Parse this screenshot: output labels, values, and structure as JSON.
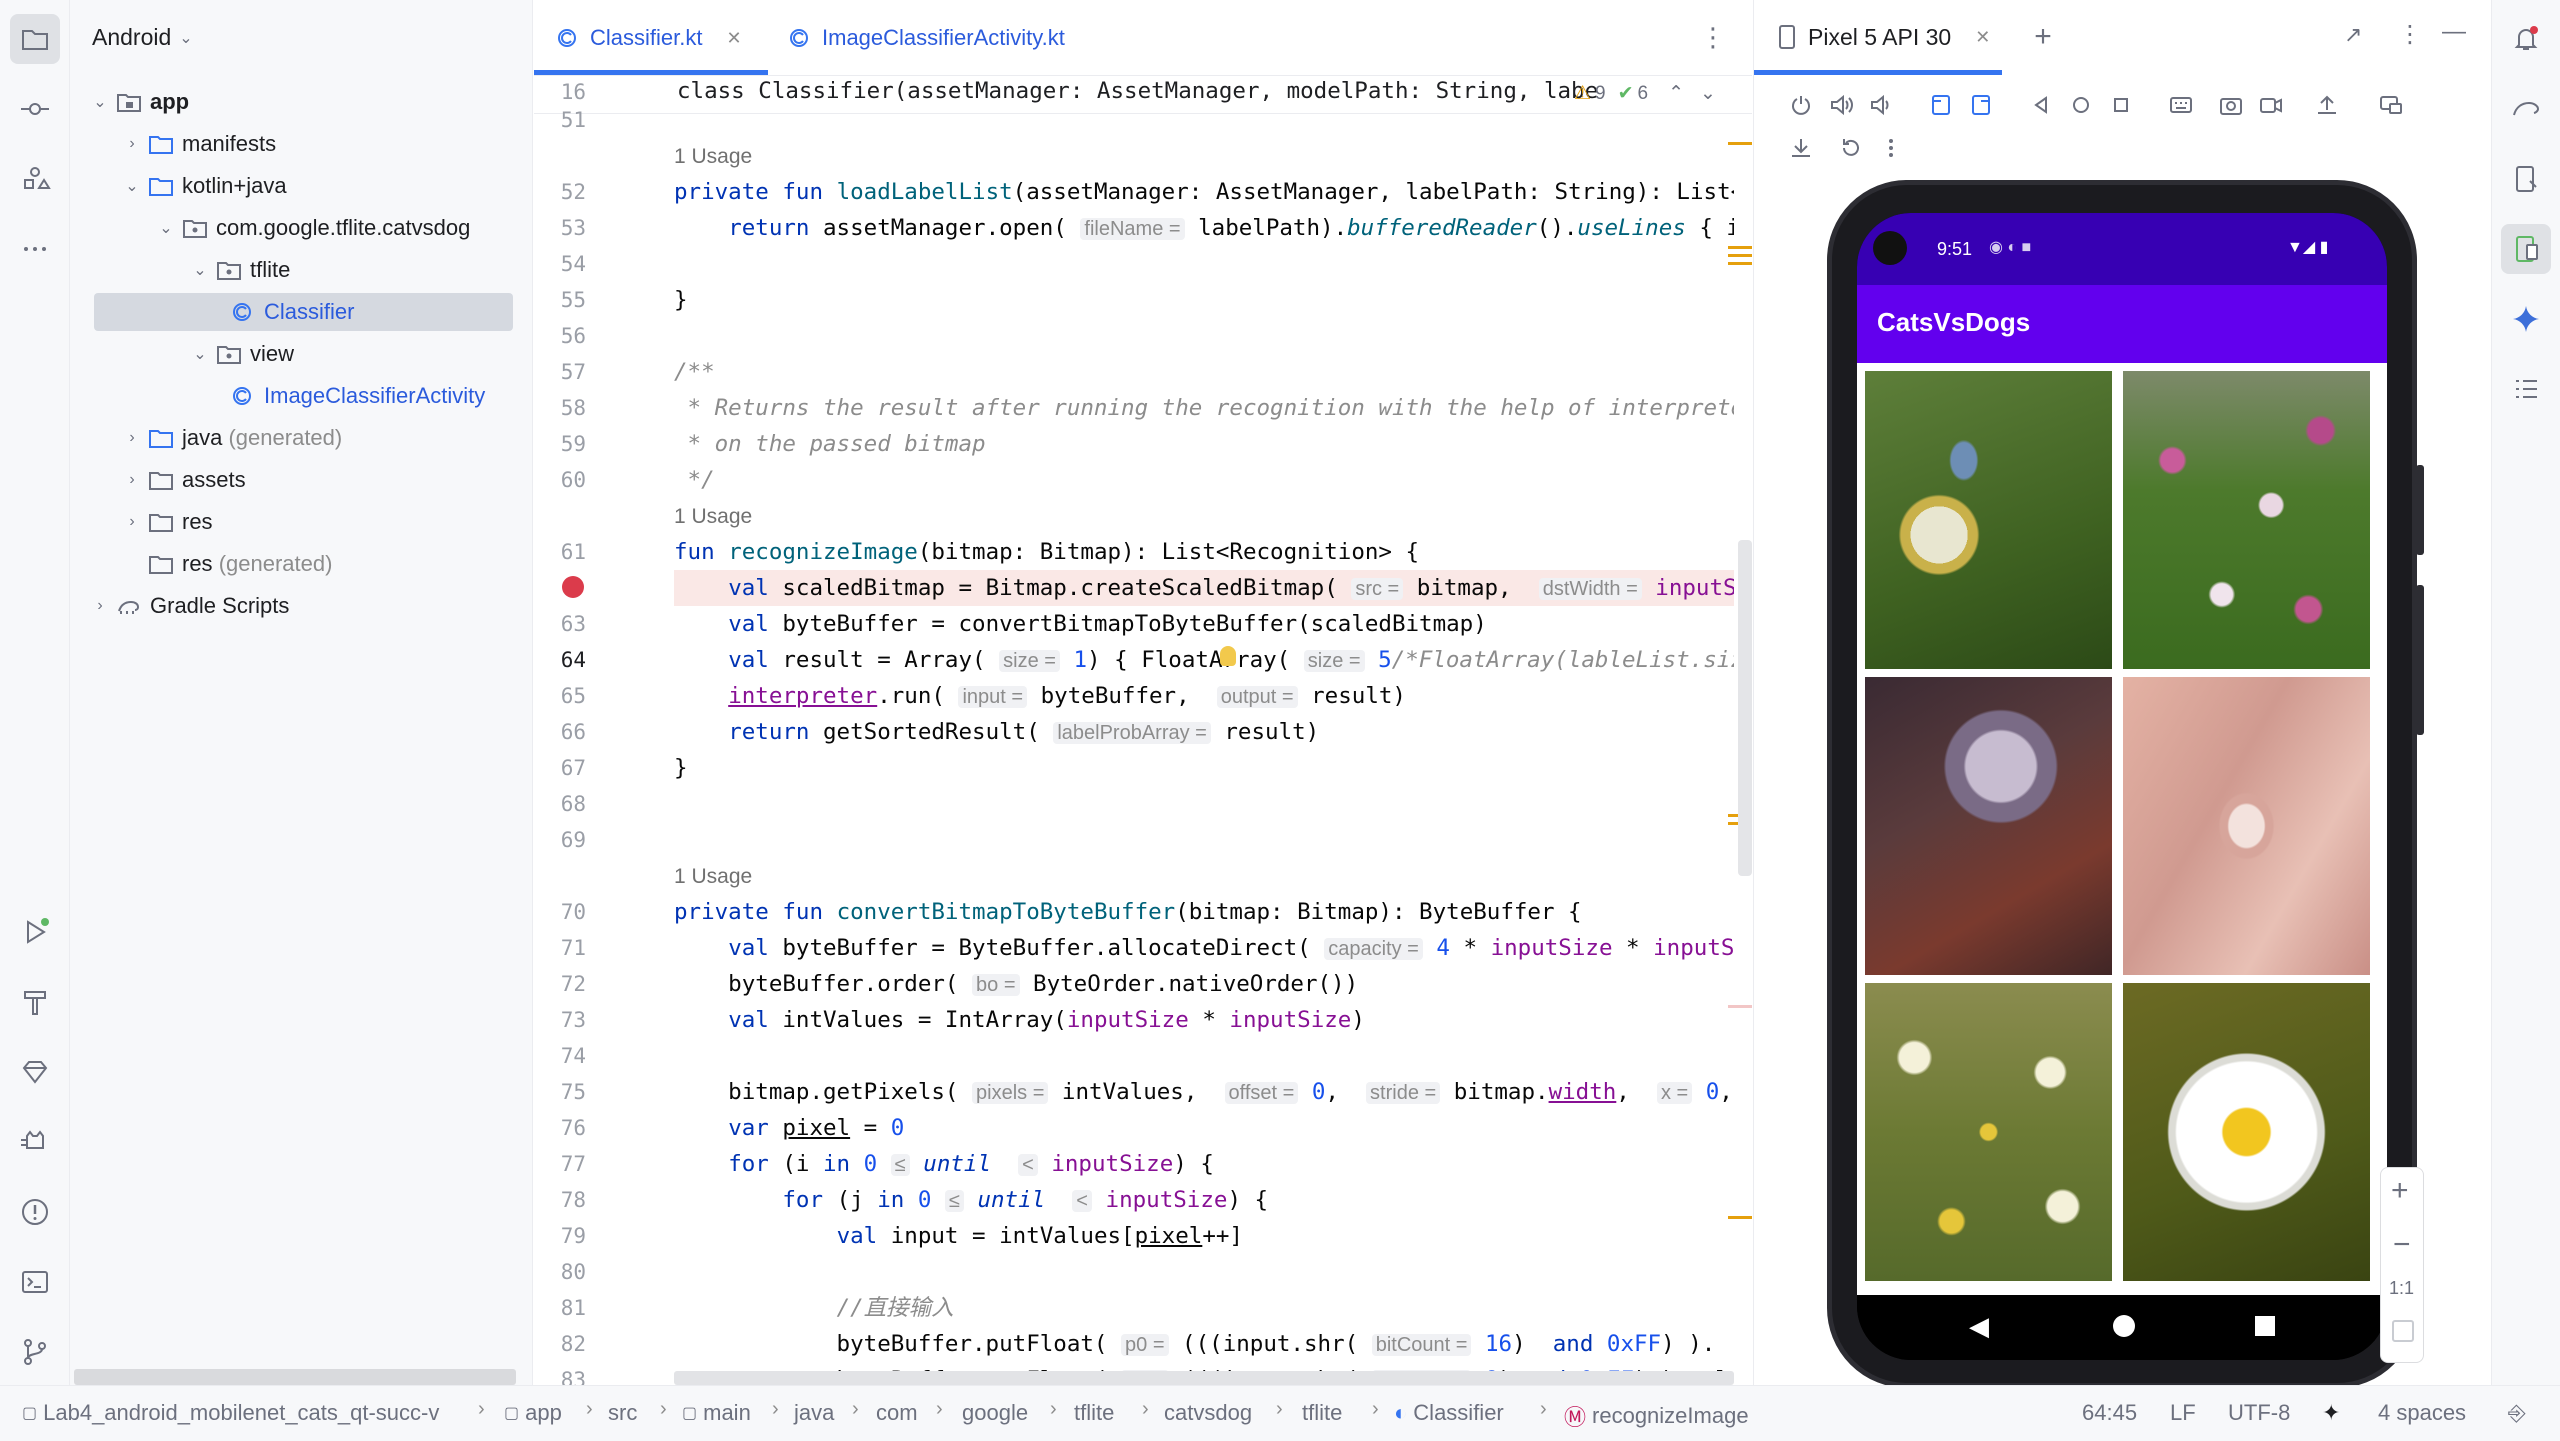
{
  "project_panel": {
    "title": "Android",
    "tree": [
      {
        "label": "app",
        "extra": ""
      },
      {
        "label": "manifests",
        "extra": ""
      },
      {
        "label": "kotlin+java",
        "extra": ""
      },
      {
        "label": "com.google.tflite.catvsdog",
        "extra": ""
      },
      {
        "label": "tflite",
        "extra": ""
      },
      {
        "label": "Classifier",
        "extra": ""
      },
      {
        "label": "view",
        "extra": ""
      },
      {
        "label": "ImageClassifierActivity",
        "extra": ""
      },
      {
        "label": "java",
        "extra": "(generated)"
      },
      {
        "label": "assets",
        "extra": ""
      },
      {
        "label": "res",
        "extra": ""
      },
      {
        "label": "res",
        "extra": "(generated)"
      },
      {
        "label": "Gradle Scripts",
        "extra": ""
      }
    ]
  },
  "editor": {
    "tabs": [
      {
        "label": "Classifier.kt",
        "active": true
      },
      {
        "label": "ImageClassifierActivity.kt",
        "active": false
      }
    ],
    "sticky": {
      "line": "16",
      "text": "class Classifier(assetManager: AssetManager, modelPath: String, labe",
      "warnings": "9",
      "ok": "6"
    },
    "line_numbers": [
      "51",
      "52",
      "53",
      "54",
      "55",
      "56",
      "57",
      "58",
      "59",
      "60",
      "61",
      "63",
      "64",
      "65",
      "66",
      "67",
      "68",
      "69",
      "70",
      "71",
      "72",
      "73",
      "74",
      "75",
      "76",
      "77",
      "78",
      "79",
      "80",
      "81",
      "82",
      "83"
    ],
    "usage_label": "1 Usage"
  },
  "device": {
    "tab_label": "Pixel 5 API 30",
    "time": "9:51",
    "app_title": "CatsVsDogs",
    "zoom_label": "1:1"
  },
  "status": {
    "breadcrumbs": [
      "Lab4_android_mobilenet_cats_qt-succ-v",
      "app",
      "src",
      "main",
      "java",
      "com",
      "google",
      "tflite",
      "catvsdog",
      "tflite",
      "Classifier",
      "recognizeImage"
    ],
    "position": "64:45",
    "line_sep": "LF",
    "encoding": "UTF-8",
    "indent": "4 spaces"
  },
  "colors": {
    "accent": "#3574f0",
    "app_bar": "#6200ee",
    "status_bar": "#3700b3",
    "breakpoint": "#db3b4b"
  }
}
